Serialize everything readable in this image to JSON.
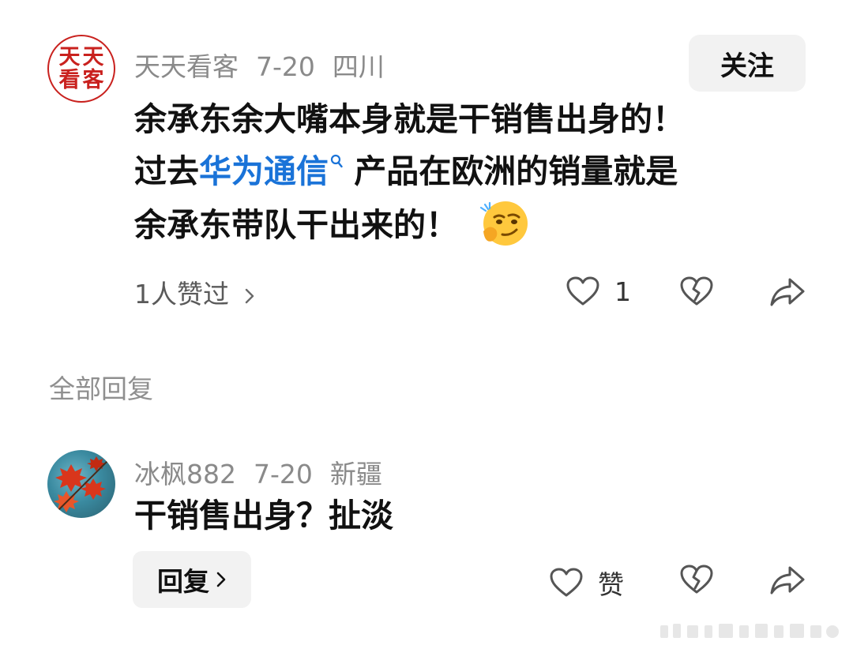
{
  "comment": {
    "avatar_text": [
      "天",
      "天",
      "看",
      "客"
    ],
    "username": "天天看客",
    "date": "7-20",
    "location": "四川",
    "follow_label": "关注",
    "line1": "余承东余大嘴本身就是干销售出身的！",
    "line2_before": "过去",
    "topic_link": "华为通信",
    "line2_after": " 产品在欧洲的销量就是",
    "line3": "余承东带队干出来的！",
    "likers_text": "1人赞过",
    "like_count": "1"
  },
  "replies_section": {
    "title": "全部回复"
  },
  "reply": {
    "username": "冰枫882",
    "date": "7-20",
    "location": "新疆",
    "text": "干销售出身？扯淡",
    "reply_button_label": "回复",
    "like_label": "赞"
  },
  "icons": {
    "like": "heart-outline-icon",
    "dislike": "broken-heart-icon",
    "share": "share-arrow-icon",
    "emoji": "smirk-emoji-icon"
  },
  "colors": {
    "link": "#1a73d8",
    "seal_red": "#c9211e",
    "button_bg": "#f2f2f2"
  }
}
